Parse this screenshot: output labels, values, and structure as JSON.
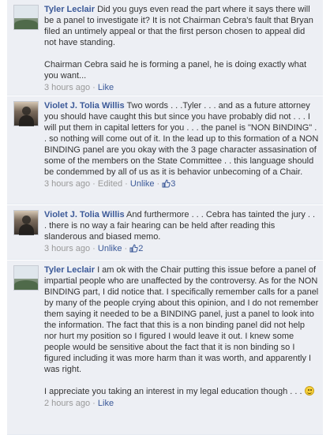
{
  "comments": [
    {
      "author": "Tyler Leclair",
      "paragraphs": [
        "Did you guys even read the part where it says there will be a panel to investigate it? It is not Chairman Cebra's fault that Bryan filed an untimely appeal or that the first person chosen to appeal did not have standing.",
        "Chairman Cebra said he is forming a panel, he is doing exactly what you want..."
      ],
      "time": "3 hours ago",
      "action": "Like"
    },
    {
      "author": "Violet J. Tolia Willis",
      "paragraphs": [
        "Two words . . .Tyler . . . and as a future attorney you should have caught this but since you have probably did not . . . I will put them in capital letters for you . . . the panel is \"NON BINDING\" . . so nothing will come out of it. In the lead up to this formation of a NON BINDING panel are you okay with the 3 page character assasination of some of the members on the State Committee . . this language should be condemmed by all of us as it is behavior unbecoming of a Chair."
      ],
      "time": "3 hours ago",
      "edited": "Edited",
      "action": "Unlike",
      "likes": "3"
    },
    {
      "author": "Violet J. Tolia Willis",
      "paragraphs": [
        "And furthermore . . . Cebra has tainted the jury . . . there is no way a fair hearing can be held after reading this slanderous and biased memo."
      ],
      "time": "3 hours ago",
      "action": "Unlike",
      "likes": "2"
    },
    {
      "author": "Tyler Leclair",
      "paragraphs": [
        "I am ok with the Chair putting this issue before a panel of impartial people who are unaffected by the controversy. As for the NON BINDING part, I did notice that. I specifically remember calls for a panel by many of the people crying about this opinion, and I do not remember them saying it needed to be a BINDING panel, just a panel to look into the information. The fact that this is a non binding panel did not help nor hurt my position so I figured I would leave it out. I knew some people would be sensitive about the fact that it is non binding so I figured including it was more harm than it was worth, and apparently I was right.",
        "I appreciate you taking an interest in my legal education though . . ."
      ],
      "time": "2 hours ago",
      "action": "Like",
      "icons": {
        "avatar1": "landscape-avatar",
        "avatar2": "person-avatar",
        "thumb": "thumbs-up-icon",
        "emoji": "smiley-emoji-icon"
      }
    }
  ],
  "separator": "·",
  "colors": {
    "link": "#3b5998",
    "background": "#edeff4",
    "meta": "#999999"
  }
}
